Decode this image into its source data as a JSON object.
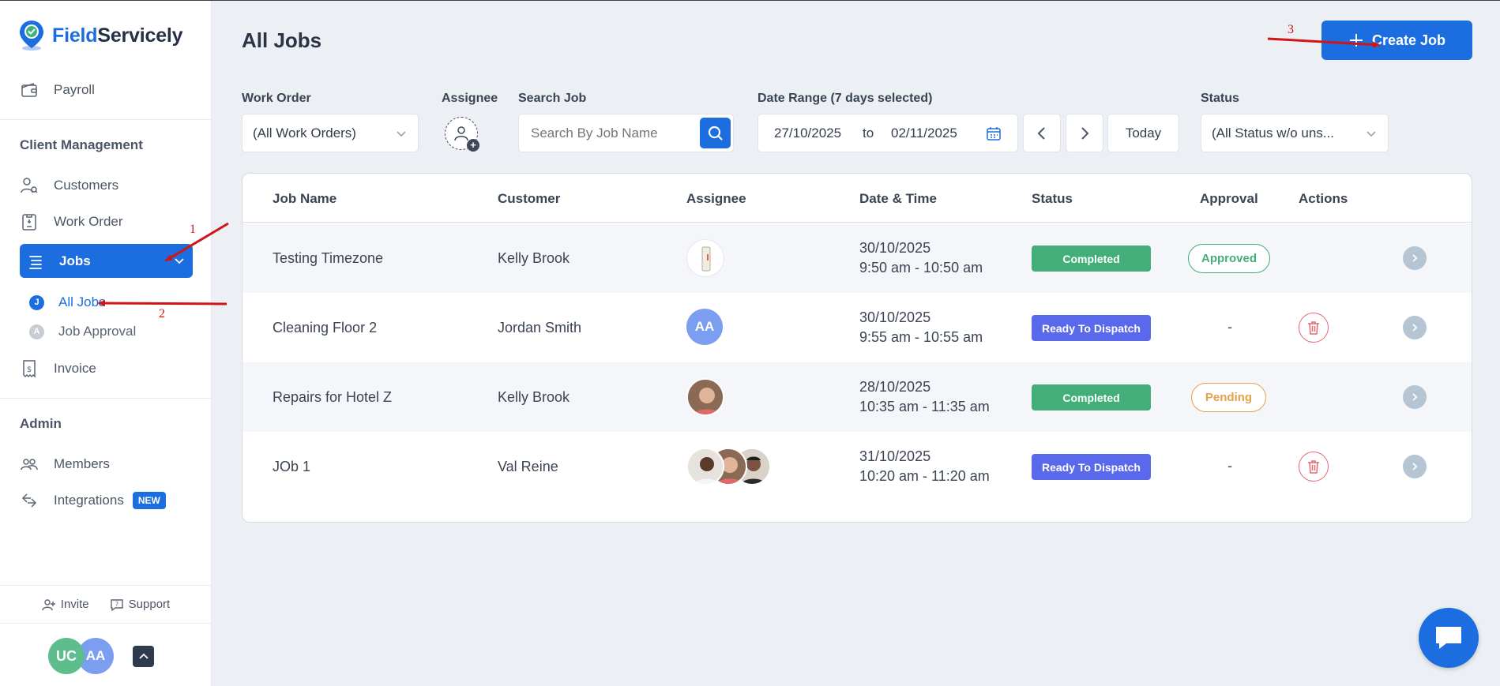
{
  "app": {
    "brand_part1": "Field",
    "brand_part2": "Servicely"
  },
  "sidebar": {
    "payroll": "Payroll",
    "section_client": "Client Management",
    "customers": "Customers",
    "work_order": "Work Order",
    "jobs": "Jobs",
    "all_jobs": "All Jobs",
    "all_jobs_letter": "J",
    "job_approval": "Job Approval",
    "job_approval_letter": "A",
    "invoice": "Invoice",
    "section_admin": "Admin",
    "members": "Members",
    "integrations": "Integrations",
    "new_badge": "NEW",
    "invite": "Invite",
    "support": "Support",
    "user1_initials": "UC",
    "user2_initials": "AA"
  },
  "header": {
    "title": "All Jobs",
    "create_button": "Create Job"
  },
  "filters": {
    "work_order_label": "Work Order",
    "work_order_value": "(All Work Orders)",
    "assignee_label": "Assignee",
    "search_label": "Search Job",
    "search_placeholder": "Search By Job Name",
    "date_range_label": "Date Range (7 days selected)",
    "date_from": "27/10/2025",
    "date_to_word": "to",
    "date_to": "02/11/2025",
    "today_button": "Today",
    "status_label": "Status",
    "status_value": "(All Status w/o uns..."
  },
  "table": {
    "headers": {
      "job_name": "Job Name",
      "customer": "Customer",
      "assignee": "Assignee",
      "date_time": "Date & Time",
      "status": "Status",
      "approval": "Approval",
      "actions": "Actions"
    },
    "rows": [
      {
        "job_name": "Testing Timezone",
        "customer": "Kelly Brook",
        "date": "30/10/2025",
        "time": "9:50 am - 10:50 am",
        "status": "Completed",
        "approval": "Approved"
      },
      {
        "job_name": "Cleaning Floor 2",
        "customer": "Jordan Smith",
        "assignee_initials": "AA",
        "date": "30/10/2025",
        "time": "9:55 am - 10:55 am",
        "status": "Ready To Dispatch",
        "approval": "-"
      },
      {
        "job_name": "Repairs for Hotel Z",
        "customer": "Kelly Brook",
        "date": "28/10/2025",
        "time": "10:35 am - 11:35 am",
        "status": "Completed",
        "approval": "Pending"
      },
      {
        "job_name": "JOb 1",
        "customer": "Val Reine",
        "date": "31/10/2025",
        "time": "10:20 am - 11:20 am",
        "status": "Ready To Dispatch",
        "approval": "-"
      }
    ]
  },
  "annotations": {
    "n1": "1",
    "n2": "2",
    "n3": "3"
  },
  "colors": {
    "primary": "#1c6ee0",
    "completed": "#44ae78",
    "ready": "#5a68ec",
    "pending": "#e3a24b",
    "danger": "#e06a70",
    "annotation": "#d11515"
  }
}
